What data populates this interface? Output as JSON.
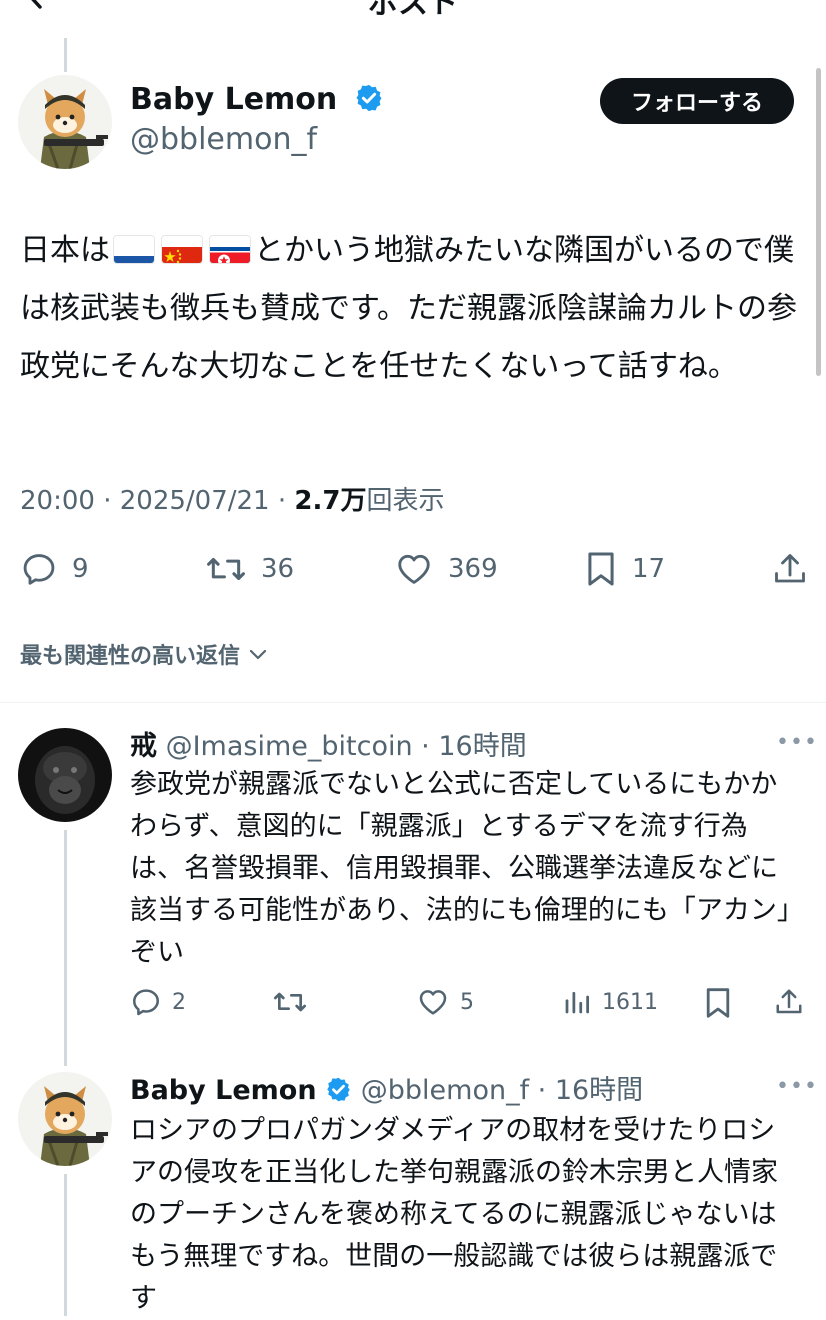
{
  "header": {
    "title": "ポスト",
    "back_icon": "chevron-left-icon"
  },
  "post": {
    "author_name": "Baby Lemon",
    "author_handle": "@bblemon_f",
    "verified": true,
    "follow_label": "フォローする",
    "body_part1": "日本は",
    "flags": [
      "Russia",
      "China",
      "North Korea"
    ],
    "body_part2": "とかいう地獄みたいな隣国がいるので僕は核武装も徴兵も賛成です。ただ親露派陰謀論カルトの参政党にそんな大切なことを任せたくないって話すね。",
    "time": "20:00",
    "date": "2025/07/21",
    "views_count": "2.7万",
    "views_suffix": "回表示",
    "stats": {
      "replies": "9",
      "reposts": "36",
      "likes": "369",
      "bookmarks": "17"
    }
  },
  "sort": {
    "label": "最も関連性の高い返信"
  },
  "replies": [
    {
      "name": "戒",
      "handle": "@Imasime_bitcoin",
      "time": "16時間",
      "verified": false,
      "text": "参政党が親露派でないと公式に否定しているにもかかわらず、意図的に「親露派」とするデマを流す行為は、名誉毀損罪、信用毀損罪、公職選挙法違反などに該当する可能性があり、法的にも倫理的にも「アカン」ぞい",
      "stats": {
        "replies": "2",
        "reposts": "",
        "likes": "5",
        "views": "1611"
      }
    },
    {
      "name": "Baby Lemon",
      "handle": "@bblemon_f",
      "time": "16時間",
      "verified": true,
      "text": "ロシアのプロパガンダメディアの取材を受けたりロシアの侵攻を正当化した挙句親露派の鈴木宗男と人情家のプーチンさんを褒め称えてるのに親露派じゃないはもう無理ですね。世間の一般認識では彼らは親露派です"
    }
  ],
  "colors": {
    "text": "#0f1419",
    "secondary": "#536471",
    "verified_blue": "#1d9bf0",
    "thread_line": "#cfd9de",
    "follow_bg": "#0f1419"
  }
}
